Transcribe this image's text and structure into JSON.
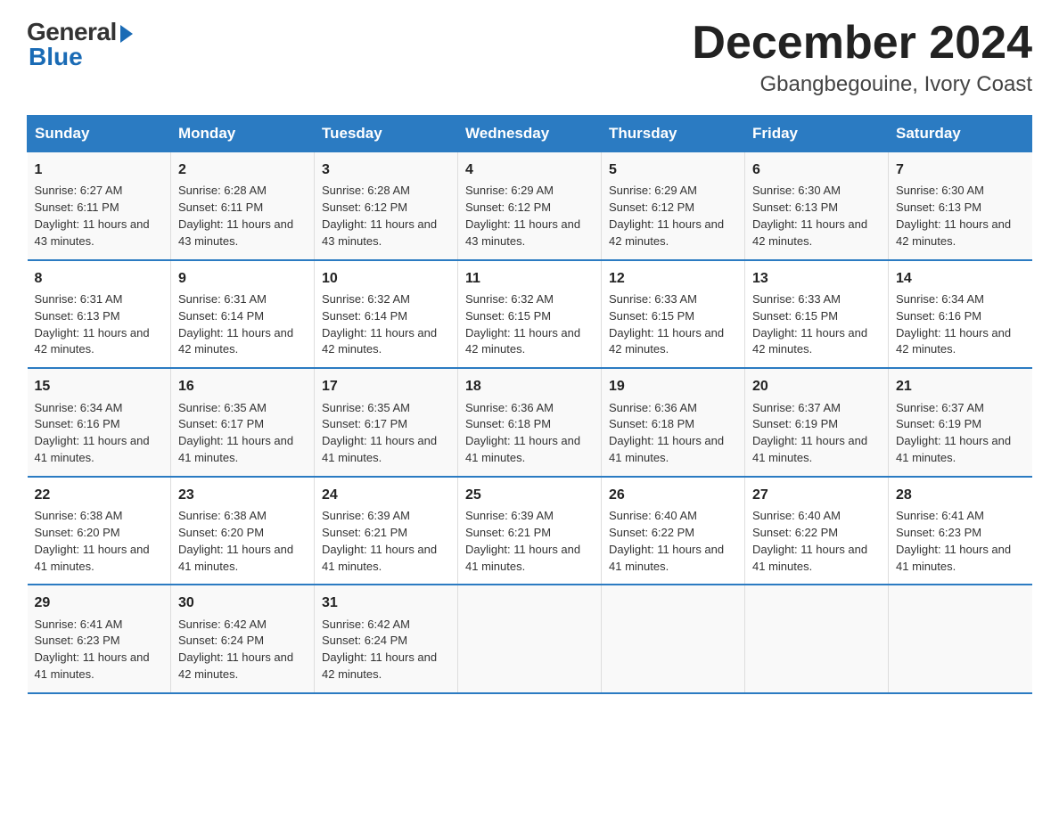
{
  "header": {
    "logo_general": "General",
    "logo_blue": "Blue",
    "month_title": "December 2024",
    "location": "Gbangbegouine, Ivory Coast"
  },
  "days_of_week": [
    "Sunday",
    "Monday",
    "Tuesday",
    "Wednesday",
    "Thursday",
    "Friday",
    "Saturday"
  ],
  "weeks": [
    [
      {
        "day": "1",
        "sunrise": "6:27 AM",
        "sunset": "6:11 PM",
        "daylight": "11 hours and 43 minutes."
      },
      {
        "day": "2",
        "sunrise": "6:28 AM",
        "sunset": "6:11 PM",
        "daylight": "11 hours and 43 minutes."
      },
      {
        "day": "3",
        "sunrise": "6:28 AM",
        "sunset": "6:12 PM",
        "daylight": "11 hours and 43 minutes."
      },
      {
        "day": "4",
        "sunrise": "6:29 AM",
        "sunset": "6:12 PM",
        "daylight": "11 hours and 43 minutes."
      },
      {
        "day": "5",
        "sunrise": "6:29 AM",
        "sunset": "6:12 PM",
        "daylight": "11 hours and 42 minutes."
      },
      {
        "day": "6",
        "sunrise": "6:30 AM",
        "sunset": "6:13 PM",
        "daylight": "11 hours and 42 minutes."
      },
      {
        "day": "7",
        "sunrise": "6:30 AM",
        "sunset": "6:13 PM",
        "daylight": "11 hours and 42 minutes."
      }
    ],
    [
      {
        "day": "8",
        "sunrise": "6:31 AM",
        "sunset": "6:13 PM",
        "daylight": "11 hours and 42 minutes."
      },
      {
        "day": "9",
        "sunrise": "6:31 AM",
        "sunset": "6:14 PM",
        "daylight": "11 hours and 42 minutes."
      },
      {
        "day": "10",
        "sunrise": "6:32 AM",
        "sunset": "6:14 PM",
        "daylight": "11 hours and 42 minutes."
      },
      {
        "day": "11",
        "sunrise": "6:32 AM",
        "sunset": "6:15 PM",
        "daylight": "11 hours and 42 minutes."
      },
      {
        "day": "12",
        "sunrise": "6:33 AM",
        "sunset": "6:15 PM",
        "daylight": "11 hours and 42 minutes."
      },
      {
        "day": "13",
        "sunrise": "6:33 AM",
        "sunset": "6:15 PM",
        "daylight": "11 hours and 42 minutes."
      },
      {
        "day": "14",
        "sunrise": "6:34 AM",
        "sunset": "6:16 PM",
        "daylight": "11 hours and 42 minutes."
      }
    ],
    [
      {
        "day": "15",
        "sunrise": "6:34 AM",
        "sunset": "6:16 PM",
        "daylight": "11 hours and 41 minutes."
      },
      {
        "day": "16",
        "sunrise": "6:35 AM",
        "sunset": "6:17 PM",
        "daylight": "11 hours and 41 minutes."
      },
      {
        "day": "17",
        "sunrise": "6:35 AM",
        "sunset": "6:17 PM",
        "daylight": "11 hours and 41 minutes."
      },
      {
        "day": "18",
        "sunrise": "6:36 AM",
        "sunset": "6:18 PM",
        "daylight": "11 hours and 41 minutes."
      },
      {
        "day": "19",
        "sunrise": "6:36 AM",
        "sunset": "6:18 PM",
        "daylight": "11 hours and 41 minutes."
      },
      {
        "day": "20",
        "sunrise": "6:37 AM",
        "sunset": "6:19 PM",
        "daylight": "11 hours and 41 minutes."
      },
      {
        "day": "21",
        "sunrise": "6:37 AM",
        "sunset": "6:19 PM",
        "daylight": "11 hours and 41 minutes."
      }
    ],
    [
      {
        "day": "22",
        "sunrise": "6:38 AM",
        "sunset": "6:20 PM",
        "daylight": "11 hours and 41 minutes."
      },
      {
        "day": "23",
        "sunrise": "6:38 AM",
        "sunset": "6:20 PM",
        "daylight": "11 hours and 41 minutes."
      },
      {
        "day": "24",
        "sunrise": "6:39 AM",
        "sunset": "6:21 PM",
        "daylight": "11 hours and 41 minutes."
      },
      {
        "day": "25",
        "sunrise": "6:39 AM",
        "sunset": "6:21 PM",
        "daylight": "11 hours and 41 minutes."
      },
      {
        "day": "26",
        "sunrise": "6:40 AM",
        "sunset": "6:22 PM",
        "daylight": "11 hours and 41 minutes."
      },
      {
        "day": "27",
        "sunrise": "6:40 AM",
        "sunset": "6:22 PM",
        "daylight": "11 hours and 41 minutes."
      },
      {
        "day": "28",
        "sunrise": "6:41 AM",
        "sunset": "6:23 PM",
        "daylight": "11 hours and 41 minutes."
      }
    ],
    [
      {
        "day": "29",
        "sunrise": "6:41 AM",
        "sunset": "6:23 PM",
        "daylight": "11 hours and 41 minutes."
      },
      {
        "day": "30",
        "sunrise": "6:42 AM",
        "sunset": "6:24 PM",
        "daylight": "11 hours and 42 minutes."
      },
      {
        "day": "31",
        "sunrise": "6:42 AM",
        "sunset": "6:24 PM",
        "daylight": "11 hours and 42 minutes."
      },
      {
        "day": "",
        "sunrise": "",
        "sunset": "",
        "daylight": ""
      },
      {
        "day": "",
        "sunrise": "",
        "sunset": "",
        "daylight": ""
      },
      {
        "day": "",
        "sunrise": "",
        "sunset": "",
        "daylight": ""
      },
      {
        "day": "",
        "sunrise": "",
        "sunset": "",
        "daylight": ""
      }
    ]
  ]
}
